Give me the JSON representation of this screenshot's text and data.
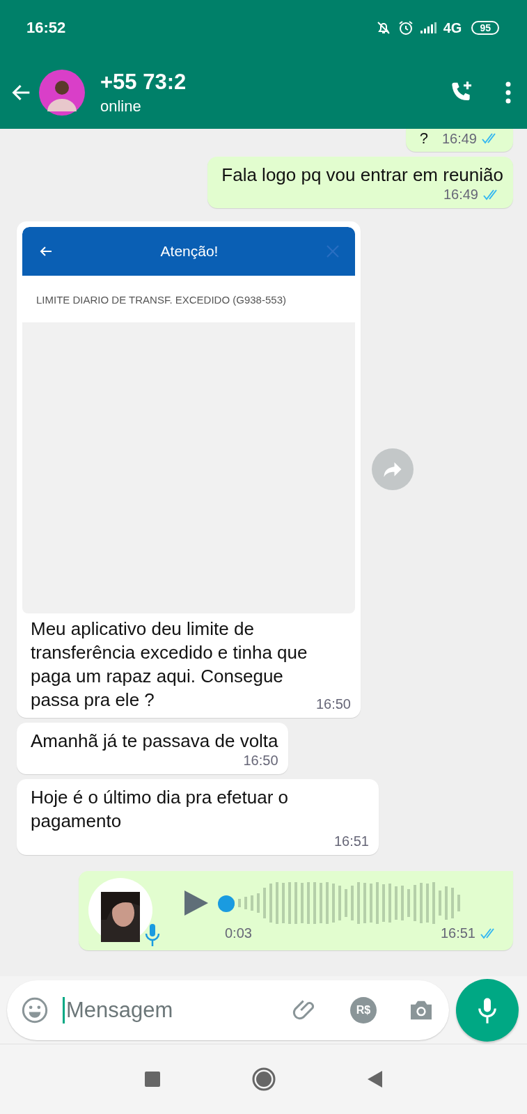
{
  "status_bar": {
    "time": "16:52",
    "network": "4G",
    "battery": "95"
  },
  "chat_header": {
    "name": "+55 73:2",
    "status": "online"
  },
  "messages": [
    {
      "kind": "text",
      "outgoing": true,
      "text": "?",
      "time": "16:49",
      "read": true
    },
    {
      "kind": "text",
      "outgoing": true,
      "text": "Fala logo pq vou entrar em reunião",
      "time": "16:49",
      "read": true
    },
    {
      "kind": "image",
      "outgoing": false,
      "screen_title": "Atenção!",
      "screen_text": "LIMITE DIARIO DE TRANSF. EXCEDIDO (G938-553)",
      "text": "Meu aplicativo deu limite de transferência excedido e tinha que paga um rapaz aqui. Consegue passa pra ele ?",
      "time": "16:50"
    },
    {
      "kind": "text",
      "outgoing": false,
      "text": "Amanhã já te passava de volta",
      "time": "16:50"
    },
    {
      "kind": "text",
      "outgoing": false,
      "text": "Hoje é o último dia pra efetuar o pagamento",
      "time": "16:51"
    },
    {
      "kind": "audio",
      "outgoing": true,
      "duration": "0:03",
      "time": "16:51",
      "read": true
    }
  ],
  "composer": {
    "placeholder": "Mensagem",
    "currency": "R$"
  }
}
